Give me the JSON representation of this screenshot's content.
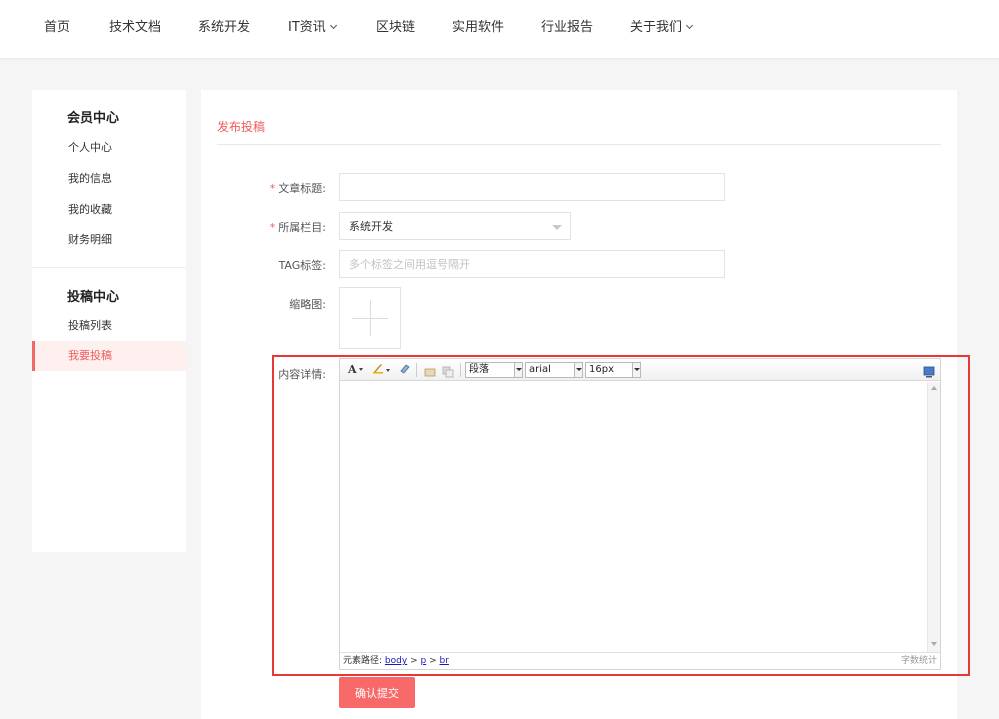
{
  "nav": {
    "items": [
      {
        "label": "首页",
        "has_dropdown": false
      },
      {
        "label": "技术文档",
        "has_dropdown": false
      },
      {
        "label": "系统开发",
        "has_dropdown": false
      },
      {
        "label": "IT资讯",
        "has_dropdown": true
      },
      {
        "label": "区块链",
        "has_dropdown": false
      },
      {
        "label": "实用软件",
        "has_dropdown": false
      },
      {
        "label": "行业报告",
        "has_dropdown": false
      },
      {
        "label": "关于我们",
        "has_dropdown": true
      }
    ]
  },
  "sidebar": {
    "member_heading": "会员中心",
    "member_items": [
      "个人中心",
      "我的信息",
      "我的收藏",
      "财务明细"
    ],
    "submit_heading": "投稿中心",
    "submit_items": [
      "投稿列表",
      "我要投稿"
    ],
    "active_item": "我要投稿"
  },
  "form": {
    "panel_title": "发布投稿",
    "required_mark": "*",
    "title_label": "文章标题:",
    "title_value": "",
    "category_label": "所属栏目:",
    "category_value": "系统开发",
    "tag_label": "TAG标签:",
    "tag_placeholder": "多个标签之间用逗号隔开",
    "thumb_label": "缩略图:",
    "content_label": "内容详情:",
    "submit_label": "确认提交"
  },
  "editor": {
    "paragraph_select": "段落",
    "font_select": "arial",
    "size_select": "16px",
    "path_label": "元素路径:",
    "path": [
      "body",
      "p",
      "br"
    ],
    "path_sep": ">",
    "wordcount_label": "字数统计",
    "content": ""
  },
  "colors": {
    "accent": "#f05c5c",
    "highlight": "#e53935",
    "button": "#f86a6a"
  }
}
